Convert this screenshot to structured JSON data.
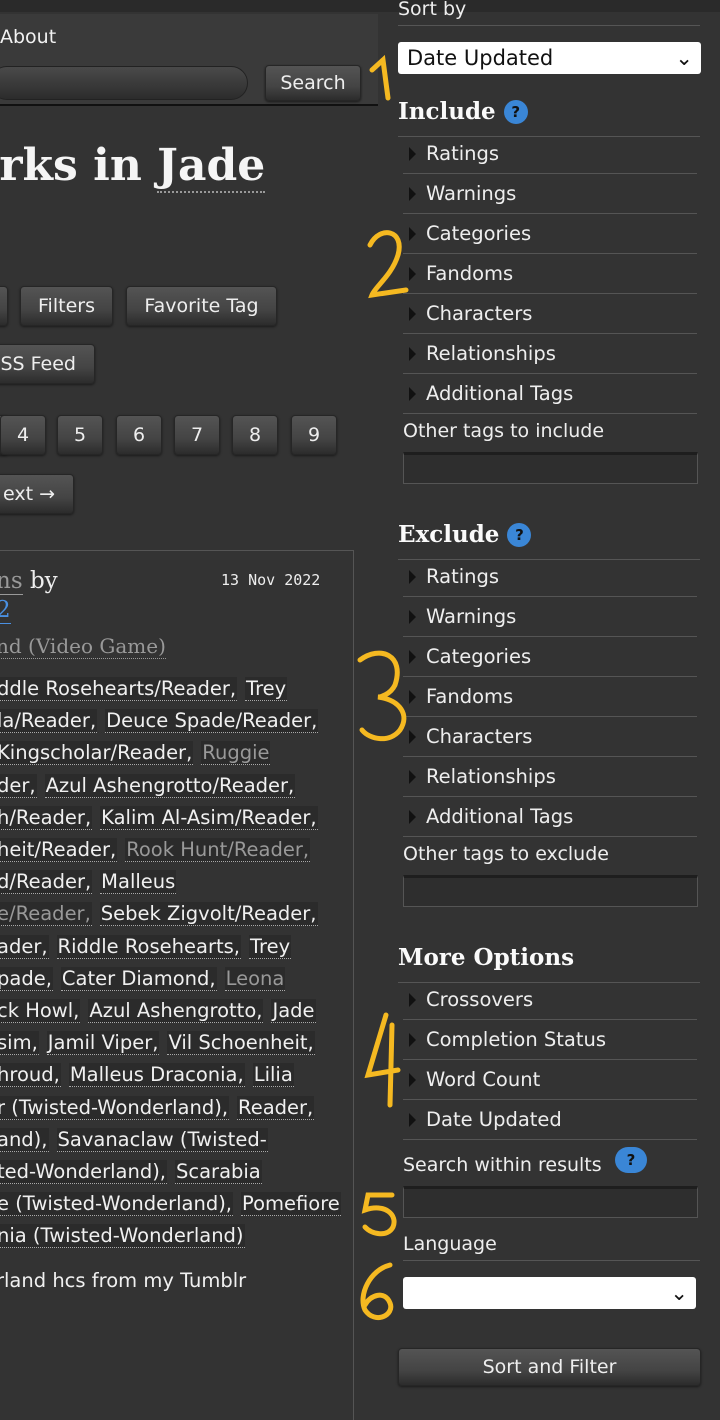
{
  "header": {
    "about": "About",
    "search_button": "Search",
    "search_value": ""
  },
  "page_title": {
    "prefix": "orks in ",
    "tag": "Jade"
  },
  "actions": {
    "filters": "Filters",
    "favorite_tag": "Favorite Tag",
    "rss_feed": "SS Feed"
  },
  "pagination": {
    "pages": [
      "4",
      "5",
      "6",
      "7",
      "8",
      "9"
    ],
    "next": "ext →"
  },
  "work": {
    "title_fragment": "ns",
    "by": "by",
    "author_fragment": "2",
    "date": "13 Nov 2022",
    "fandom": "nd (Video Game)",
    "tag_lines": [
      [
        {
          "t": "ddle Rosehearts/Reader,"
        },
        {
          "t": "Trey"
        }
      ],
      [
        {
          "t": "la/Reader,"
        },
        {
          "t": "Deuce Spade/Reader,"
        }
      ],
      [
        {
          "t": "Kingscholar/Reader,"
        },
        {
          "t": "Ruggie",
          "gray": true
        }
      ],
      [
        {
          "t": "der,"
        },
        {
          "t": "Azul Ashengrotto/Reader,"
        }
      ],
      [
        {
          "t": "h/Reader,"
        },
        {
          "t": "Kalim Al-Asim/Reader,"
        }
      ],
      [
        {
          "t": "heit/Reader,"
        },
        {
          "t": "Rook Hunt/Reader,",
          "gray": true
        }
      ],
      [
        {
          "t": "d/Reader,"
        },
        {
          "t": "Malleus"
        }
      ],
      [
        {
          "t": "e/Reader,",
          "gray": true
        },
        {
          "t": "Sebek Zigvolt/Reader,"
        }
      ],
      [
        {
          "t": "ader,"
        },
        {
          "t": "Riddle Rosehearts,"
        },
        {
          "t": "Trey"
        }
      ],
      [
        {
          "t": "pade,"
        },
        {
          "t": "Cater Diamond,"
        },
        {
          "t": "Leona",
          "gray": true
        }
      ],
      [
        {
          "t": "ck Howl,"
        },
        {
          "t": "Azul Ashengrotto,"
        },
        {
          "t": "Jade"
        }
      ],
      [
        {
          "t": "sim,"
        },
        {
          "t": "Jamil Viper,"
        },
        {
          "t": "Vil Schoenheit,"
        }
      ],
      [
        {
          "t": "hroud,"
        },
        {
          "t": "Malleus Draconia,"
        },
        {
          "t": "Lilia"
        }
      ],
      [
        {
          "t": "r (Twisted-Wonderland),"
        },
        {
          "t": "Reader,"
        }
      ],
      [
        {
          "t": "and),"
        },
        {
          "t": "Savanaclaw (Twisted-"
        }
      ],
      [
        {
          "t": "ted-Wonderland),"
        },
        {
          "t": "Scarabia"
        }
      ],
      [
        {
          "t": "e (Twisted-Wonderland),"
        },
        {
          "t": "Pomefiore"
        }
      ],
      [
        {
          "t": "nia (Twisted-Wonderland)"
        }
      ]
    ],
    "summary": "rland hcs from my Tumblr"
  },
  "sidebar": {
    "sort_by_label": "Sort by",
    "sort_by_value": "Date Updated",
    "include": {
      "title": "Include",
      "help": "?",
      "items": [
        "Ratings",
        "Warnings",
        "Categories",
        "Fandoms",
        "Characters",
        "Relationships",
        "Additional Tags"
      ],
      "other_label": "Other tags to include",
      "other_value": ""
    },
    "exclude": {
      "title": "Exclude",
      "help": "?",
      "items": [
        "Ratings",
        "Warnings",
        "Categories",
        "Fandoms",
        "Characters",
        "Relationships",
        "Additional Tags"
      ],
      "other_label": "Other tags to exclude",
      "other_value": ""
    },
    "more": {
      "title": "More Options",
      "items": [
        "Crossovers",
        "Completion Status",
        "Word Count",
        "Date Updated"
      ]
    },
    "search_within_label": "Search within results",
    "search_within_help": "?",
    "search_within_value": "",
    "language_label": "Language",
    "language_value": "",
    "submit": "Sort and Filter"
  },
  "annotations": {
    "color": "#f5b921",
    "labels": [
      "1",
      "2",
      "3",
      "4",
      "5",
      "6"
    ]
  },
  "colors": {
    "background": "#333333",
    "link": "#4a90e2",
    "help_badge": "#3a86d6"
  }
}
